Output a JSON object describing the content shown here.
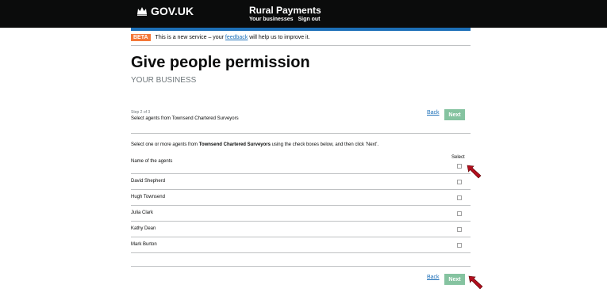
{
  "header": {
    "logo_text": "GOV.UK",
    "service_name": "Rural Payments",
    "nav": [
      "Your businesses",
      "Sign out"
    ]
  },
  "beta_banner": {
    "tag": "BETA",
    "text_before": "This is a new service – your",
    "link": "feedback",
    "text_after": "will help us to improve it."
  },
  "page": {
    "title": "Give people permission",
    "subtitle": "YOUR BUSINESS",
    "step": "Step 2 of 3",
    "step_description": "Select agents from Townsend Chartered Surveyors",
    "instruction_before": "Select one or more agents from",
    "instruction_bold": "Townsend Chartered Surveyors",
    "instruction_after": "using the check boxes below, and then click 'Next'."
  },
  "nav_buttons": {
    "back": "Back",
    "next": "Next"
  },
  "table": {
    "col_name": "Name of the agents",
    "col_select": "Select",
    "rows": [
      {
        "name": "David Shepherd"
      },
      {
        "name": "Hugh Townsend"
      },
      {
        "name": "Julia Clark"
      },
      {
        "name": "Kathy Dean"
      },
      {
        "name": "Mark Burton"
      }
    ]
  },
  "colors": {
    "header_bg": "#0b0c0c",
    "blue_strip": "#1d70b8",
    "beta_tag": "#f47738",
    "next_button": "#85c3a0",
    "annotation_arrow": "#b10e1e"
  }
}
